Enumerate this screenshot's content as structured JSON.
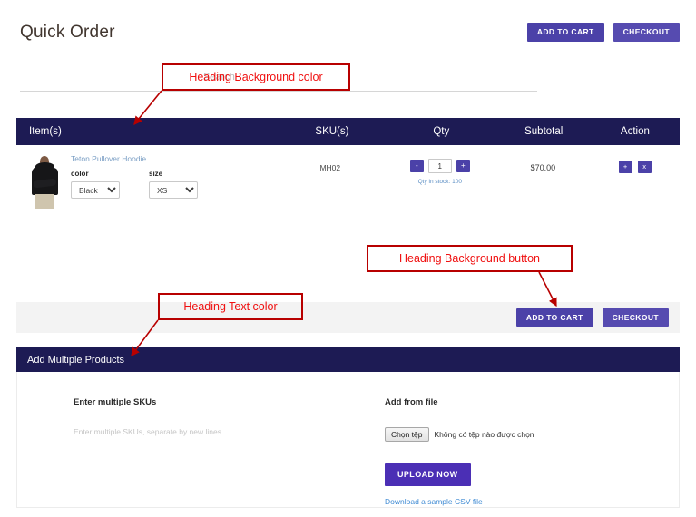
{
  "page": {
    "title": "Quick Order"
  },
  "header": {
    "add_to_cart_label": "ADD TO CART",
    "checkout_label": "CHECKOUT"
  },
  "search": {
    "placeholder": "Search",
    "value": ""
  },
  "order_table": {
    "columns": {
      "items": "Item(s)",
      "sku": "SKU(s)",
      "qty": "Qty",
      "subtotal": "Subtotal",
      "action": "Action"
    },
    "rows": [
      {
        "product_name": "Teton Pullover Hoodie",
        "color_label": "color",
        "color_value": "Black",
        "size_label": "size",
        "size_value": "XS",
        "sku": "MH02",
        "qty_decrease": "-",
        "qty_value": "1",
        "qty_increase": "+",
        "stock_note": "Qty in stock: 100",
        "subtotal": "$70.00",
        "action_add": "+",
        "action_remove": "x"
      }
    ]
  },
  "bottom_bar": {
    "add_to_cart_label": "ADD TO CART",
    "checkout_label": "CHECKOUT"
  },
  "multi_section": {
    "heading": "Add Multiple Products",
    "left": {
      "sub_heading": "Enter multiple SKUs",
      "textarea_placeholder": "Enter multiple SKUs, separate by new lines",
      "textarea_value": ""
    },
    "right": {
      "sub_heading": "Add from file",
      "file_button_label": "Chọn tệp",
      "file_status": "Không có tệp nào được chọn",
      "upload_label": "UPLOAD NOW",
      "csv_link_label": "Download a sample CSV file"
    }
  },
  "annotations": [
    {
      "text": "Heading Background color"
    },
    {
      "text": "Heading Background button"
    },
    {
      "text": "Heading Text color"
    }
  ],
  "colors": {
    "heading_background": "#1d1b54",
    "heading_text": "#ffffff",
    "button_background": "#4b41a8",
    "annotation": "#f01010",
    "annotation_border": "#b80000",
    "link": "#3f8bd4"
  }
}
